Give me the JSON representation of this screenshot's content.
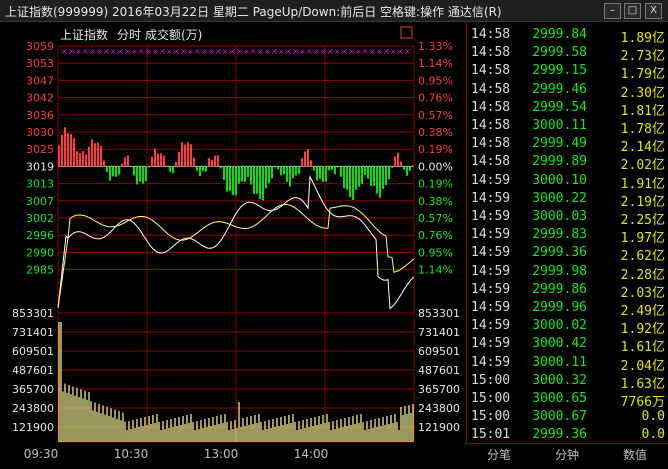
{
  "window": {
    "title": "上证指数(999999) 2016年03月22日 星期二 PageUp/Down:前后日 空格键:操作 通达信(R)",
    "buttons": {
      "minimize": "–",
      "maximize": "□",
      "close": "X"
    }
  },
  "chart_header": {
    "index_name": "上证指数",
    "period": "分时",
    "volume_label": "成交额(万)",
    "corner_button": "□"
  },
  "price_axis": {
    "left_labels": [
      "3059",
      "3053",
      "3047",
      "3042",
      "3036",
      "3030",
      "3025",
      "3019",
      "3013",
      "3007",
      "3002",
      "2996",
      "2990",
      "2985"
    ],
    "right_labels": [
      "1.33%",
      "1.14%",
      "0.95%",
      "0.76%",
      "0.57%",
      "0.38%",
      "0.19%",
      "0.00%",
      "0.19%",
      "0.38%",
      "0.57%",
      "0.76%",
      "0.95%",
      "1.14%"
    ],
    "reference_label": "3019"
  },
  "volume_axis": {
    "labels": [
      "853301",
      "731401",
      "609501",
      "487601",
      "365700",
      "243800",
      "121900"
    ]
  },
  "time_axis": {
    "labels": [
      "09:30",
      "10:30",
      "13:00",
      "14:00"
    ]
  },
  "colors": {
    "up": "#ff3b3b",
    "down": "#00e600",
    "neutral": "#e6e6e6",
    "price_line": "#ffffff",
    "avg_line": "#ffff66",
    "grid": "#8b0000",
    "volume_bar": "#ffff99",
    "magenta": "#ff00ff"
  },
  "ticks": [
    {
      "time": "14:58",
      "price": "2999.84",
      "vol": "1.89",
      "unit": "亿"
    },
    {
      "time": "14:58",
      "price": "2999.58",
      "vol": "2.73",
      "unit": "亿"
    },
    {
      "time": "14:58",
      "price": "2999.15",
      "vol": "1.79",
      "unit": "亿"
    },
    {
      "time": "14:58",
      "price": "2999.46",
      "vol": "2.30",
      "unit": "亿"
    },
    {
      "time": "14:58",
      "price": "2999.54",
      "vol": "1.81",
      "unit": "亿"
    },
    {
      "time": "14:58",
      "price": "3000.11",
      "vol": "1.78",
      "unit": "亿"
    },
    {
      "time": "14:58",
      "price": "2999.49",
      "vol": "2.14",
      "unit": "亿"
    },
    {
      "time": "14:58",
      "price": "2999.89",
      "vol": "2.02",
      "unit": "亿"
    },
    {
      "time": "14:59",
      "price": "3000.10",
      "vol": "1.91",
      "unit": "亿"
    },
    {
      "time": "14:59",
      "price": "3000.22",
      "vol": "2.19",
      "unit": "亿"
    },
    {
      "time": "14:59",
      "price": "3000.03",
      "vol": "2.25",
      "unit": "亿"
    },
    {
      "time": "14:59",
      "price": "2999.83",
      "vol": "1.97",
      "unit": "亿"
    },
    {
      "time": "14:59",
      "price": "2999.36",
      "vol": "2.62",
      "unit": "亿"
    },
    {
      "time": "14:59",
      "price": "2999.98",
      "vol": "2.28",
      "unit": "亿"
    },
    {
      "time": "14:59",
      "price": "2999.86",
      "vol": "2.03",
      "unit": "亿"
    },
    {
      "time": "14:59",
      "price": "2999.96",
      "vol": "2.49",
      "unit": "亿"
    },
    {
      "time": "14:59",
      "price": "3000.02",
      "vol": "1.92",
      "unit": "亿"
    },
    {
      "time": "14:59",
      "price": "3000.42",
      "vol": "1.61",
      "unit": "亿"
    },
    {
      "time": "14:59",
      "price": "3000.11",
      "vol": "2.04",
      "unit": "亿"
    },
    {
      "time": "15:00",
      "price": "3000.32",
      "vol": "1.63",
      "unit": "亿"
    },
    {
      "time": "15:00",
      "price": "3000.65",
      "vol": "7766",
      "unit": "万"
    },
    {
      "time": "15:00",
      "price": "3000.67",
      "vol": "0.0",
      "unit": ""
    },
    {
      "time": "15:01",
      "price": "2999.36",
      "vol": "0.0",
      "unit": ""
    }
  ],
  "tabs": [
    "分笔",
    "分钟",
    "数值"
  ]
}
